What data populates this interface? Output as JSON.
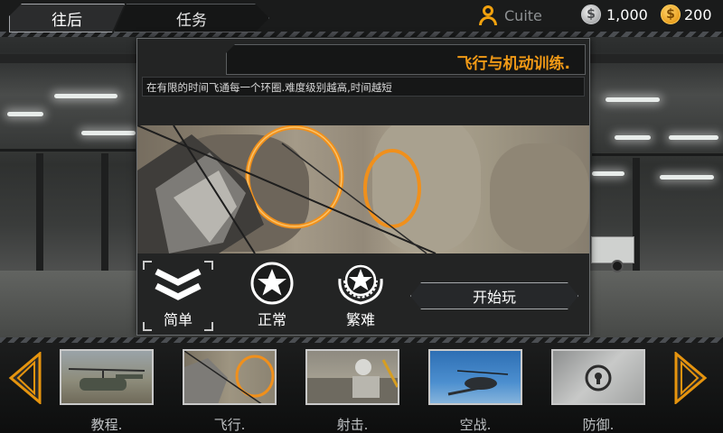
{
  "top_bar": {
    "back_tab": "往后",
    "task_tab": "任务",
    "username": "Cuite",
    "silver_amount": "1,000",
    "gold_amount": "200",
    "silver_coin_symbol": "$",
    "gold_coin_symbol": "$"
  },
  "mission": {
    "title": "飞行与机动训练.",
    "description": "在有限的时间飞通每一个环圈.难度级别越高,时间越短",
    "difficulties": [
      {
        "label": "简单",
        "icon": "chevron-rank-icon",
        "selected": true
      },
      {
        "label": "正常",
        "icon": "star-badge-icon",
        "selected": false
      },
      {
        "label": "繁难",
        "icon": "star-wreath-icon",
        "selected": false
      }
    ],
    "start_button": "开始玩"
  },
  "missions_strip": [
    {
      "label": "教程.",
      "icon": "helicopter-ground-thumb"
    },
    {
      "label": "飞行.",
      "icon": "helicopter-rings-thumb"
    },
    {
      "label": "射击.",
      "icon": "radar-site-thumb"
    },
    {
      "label": "空战.",
      "icon": "helicopter-sky-thumb"
    },
    {
      "label": "防御.",
      "icon": "locked-thumb"
    }
  ],
  "colors": {
    "accent_orange": "#f29a16",
    "gold": "#f2a20e",
    "panel": "#232424"
  }
}
